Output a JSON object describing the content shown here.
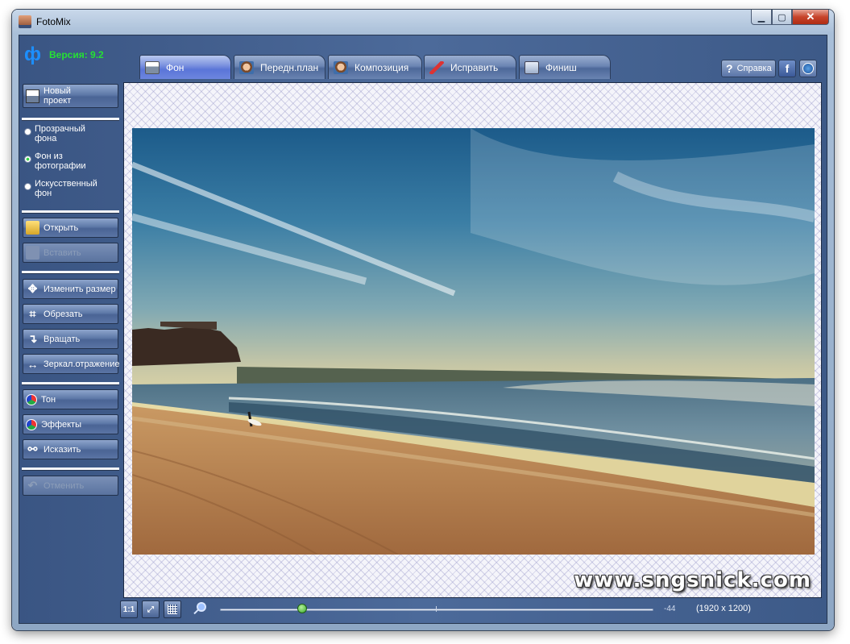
{
  "window": {
    "title": "FotoMix"
  },
  "header": {
    "version_logo": "ф",
    "version": "Версия: 9.2"
  },
  "tabs": [
    {
      "label": "Фон",
      "icon": "background-icon",
      "active": true
    },
    {
      "label": "Передн.план",
      "icon": "foreground-icon"
    },
    {
      "label": "Композиция",
      "icon": "composition-icon"
    },
    {
      "label": "Исправить",
      "icon": "brush-icon"
    },
    {
      "label": "Финиш",
      "icon": "finish-icon"
    }
  ],
  "help": {
    "label": "Справка",
    "facebook": "f"
  },
  "sidebar": {
    "new_project": "Новый проект",
    "background_options": [
      {
        "label": "Прозрачный фона",
        "selected": false
      },
      {
        "label": "Фон из фотографии",
        "selected": true
      },
      {
        "label": "Искусственный фон",
        "selected": false
      }
    ],
    "open": "Открыть",
    "paste": "Вставить",
    "resize": "Изменить размер",
    "crop": "Обрезать",
    "rotate": "Вращать",
    "mirror": "Зеркал.отражение",
    "tone": "Тон",
    "effects": "Эффекты",
    "distort": "Исказить",
    "undo": "Отменить"
  },
  "canvas": {
    "watermark": "www.sngsnick.com"
  },
  "bottom": {
    "zoom_value": "-44",
    "zoom_fraction": 0.19,
    "image_size": "(1920 x 1200)",
    "actual_size_label": "1:1"
  },
  "colors": {
    "version_text": "#25e233",
    "tab_active": "#5a75d8",
    "panel": "#4c6a9a"
  }
}
